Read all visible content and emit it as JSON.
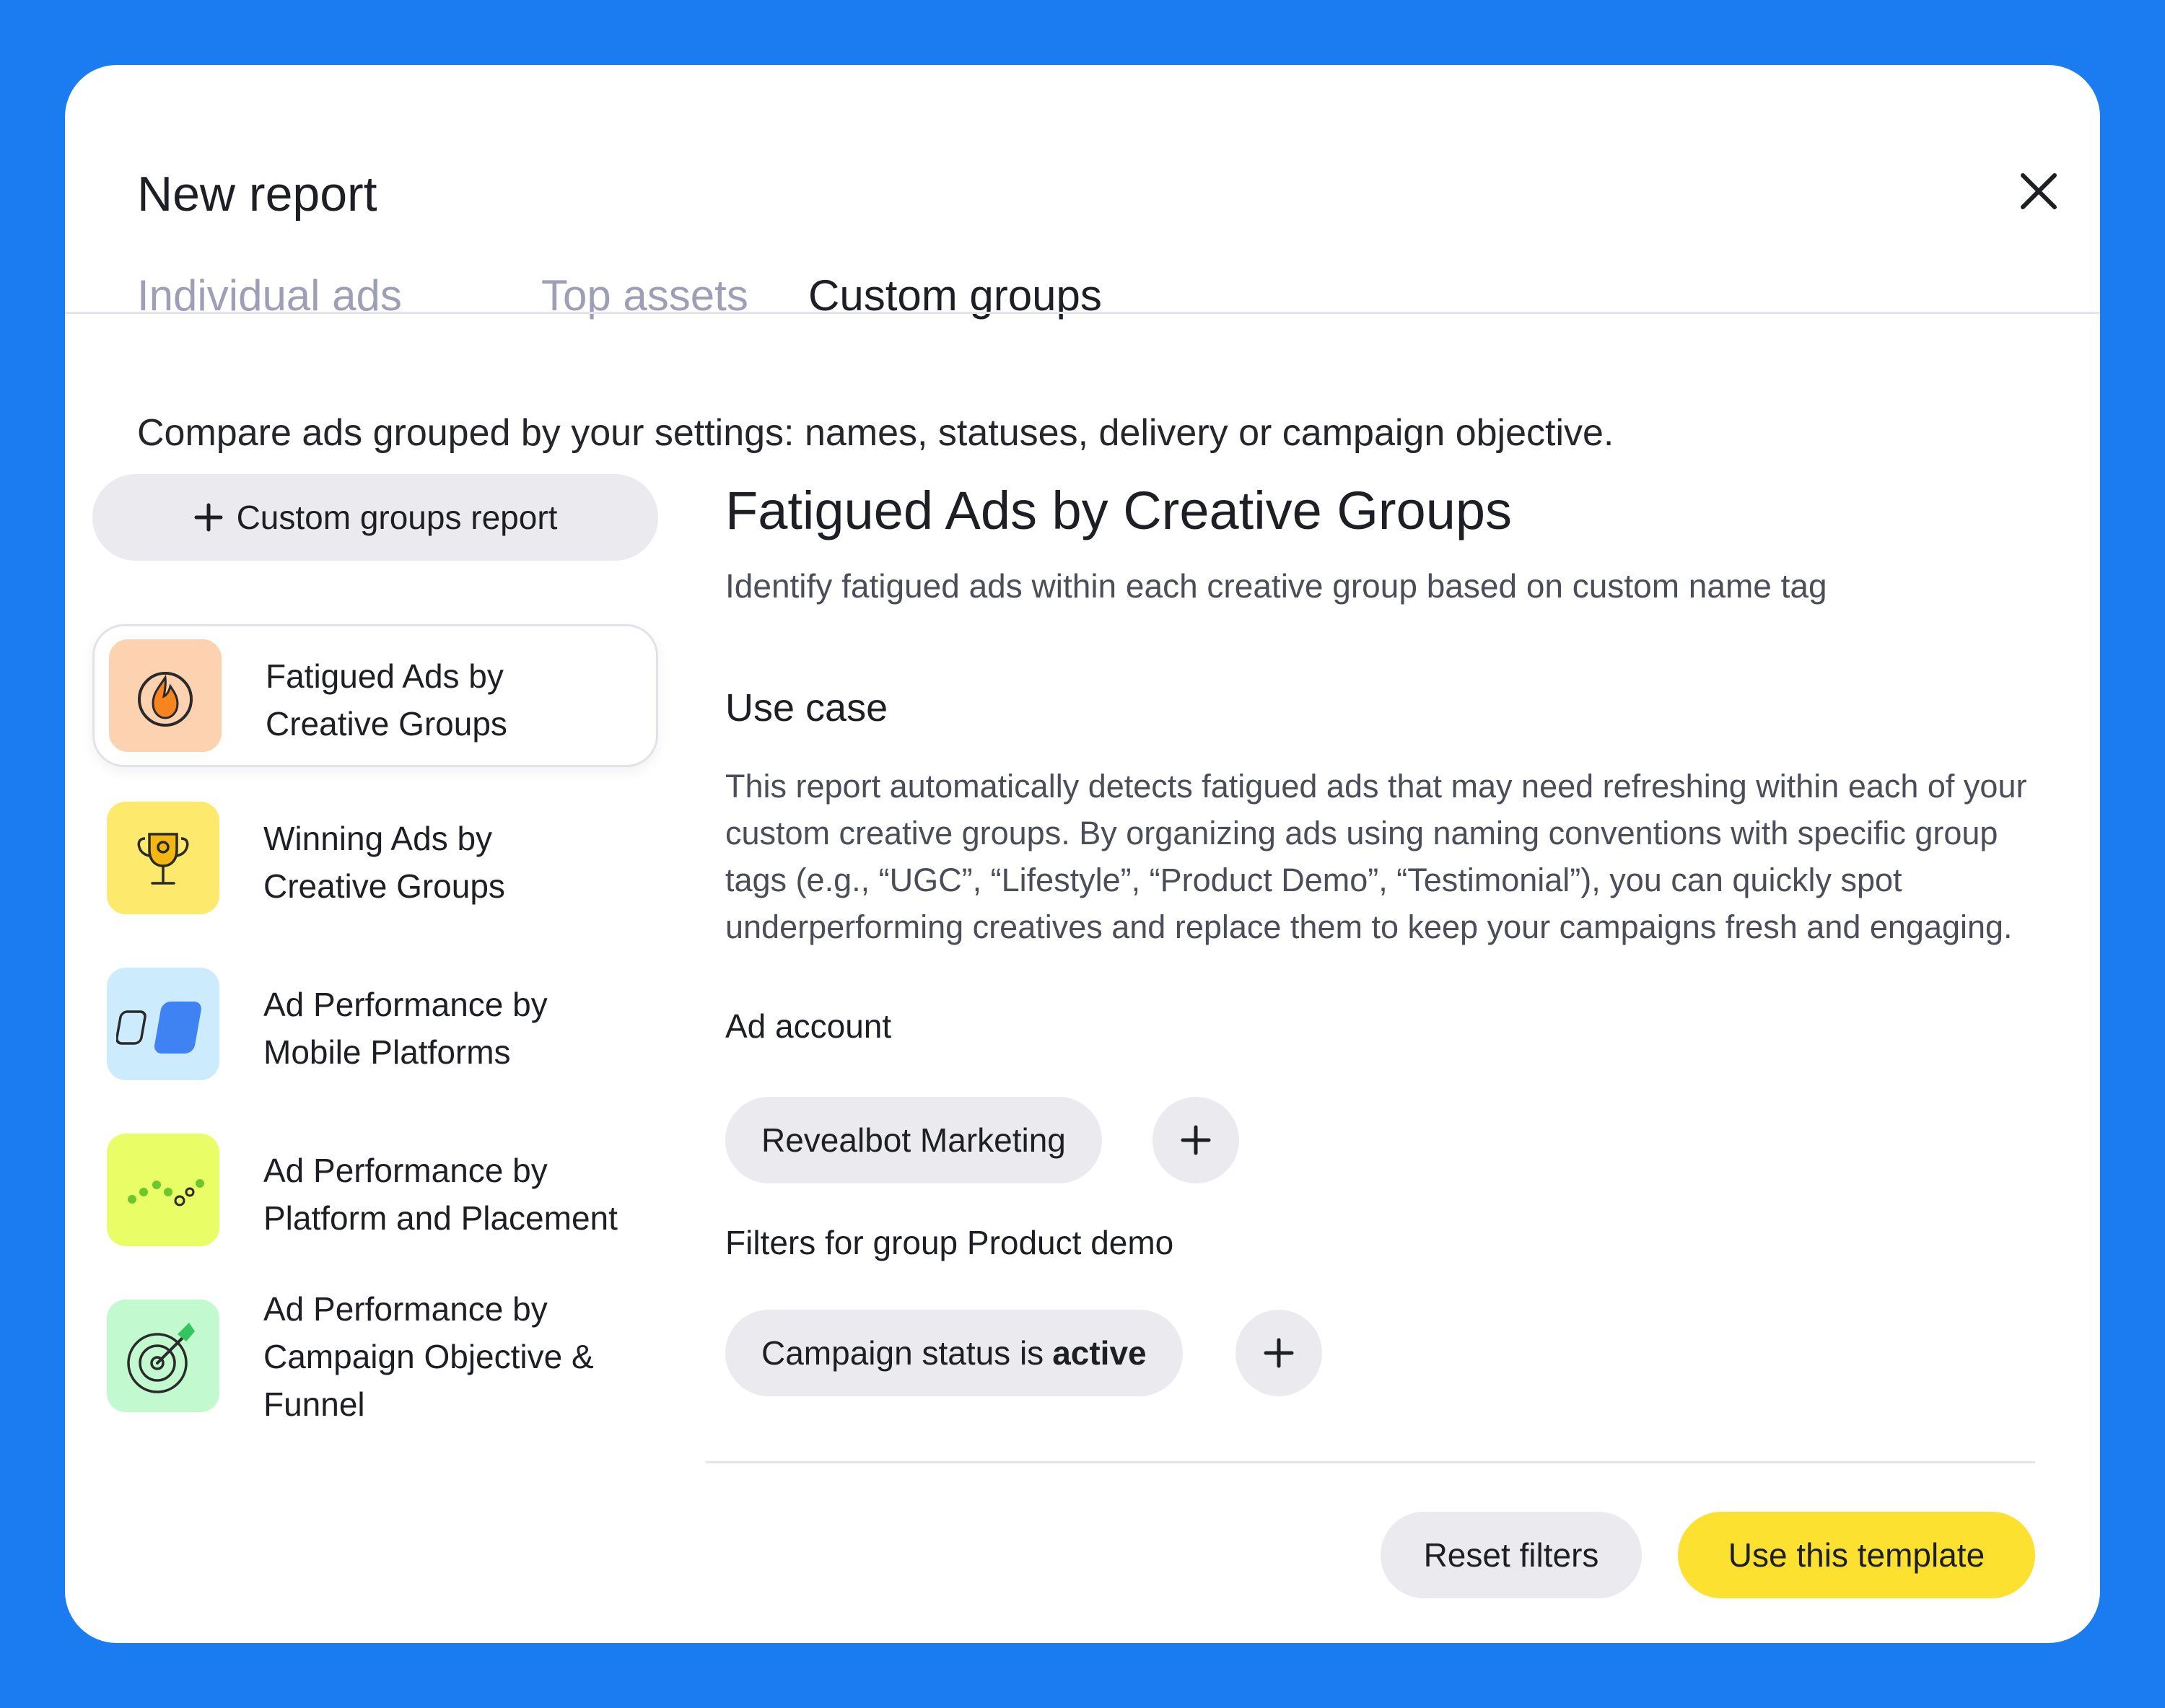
{
  "modal": {
    "title": "New report",
    "tabs": [
      {
        "label": "Individual ads",
        "active": false
      },
      {
        "label": "Top assets",
        "active": false
      },
      {
        "label": "Custom groups",
        "active": true
      }
    ],
    "subtitle": "Compare ads grouped by your settings: names, statuses, delivery or campaign objective."
  },
  "sidebar": {
    "add_button_label": "Custom groups report",
    "templates": [
      {
        "line1": "Fatigued Ads by",
        "line2": "Creative Groups",
        "line3": "",
        "icon": "flame-icon",
        "color": "#fdd2b0",
        "selected": true
      },
      {
        "line1": "Winning Ads by",
        "line2": "Creative Groups",
        "line3": "",
        "icon": "trophy-icon",
        "color": "#fde96b",
        "selected": false
      },
      {
        "line1": "Ad Performance by",
        "line2": "Mobile Platforms",
        "line3": "",
        "icon": "mobile-platforms-icon",
        "color": "#ccecfd",
        "selected": false
      },
      {
        "line1": "Ad Performance by",
        "line2": "Platform and Placement",
        "line3": "",
        "icon": "placement-dots-icon",
        "color": "#e8fd66",
        "selected": false
      },
      {
        "line1": "Ad Performance by",
        "line2": "Campaign Objective &",
        "line3": "Funnel",
        "icon": "target-icon",
        "color": "#c2f9cf",
        "selected": false
      }
    ]
  },
  "detail": {
    "title": "Fatigued Ads by Creative Groups",
    "description": "Identify fatigued ads within each creative group based on custom name tag",
    "use_case_heading": "Use case",
    "use_case_text": "This report automatically detects fatigued ads that may need refreshing within each of your custom creative groups. By organizing ads using naming conventions with specific group tags (e.g., “UGC”, “Lifestyle”, “Product Demo”, “Testimonial”), you can quickly spot underperforming creatives and replace them to keep your campaigns fresh and engaging.",
    "ad_account_label": "Ad account",
    "ad_account_chip": "Revealbot Marketing",
    "filters_label": "Filters for group Product demo",
    "filter_chip_prefix": "Campaign status is",
    "filter_chip_value": "active"
  },
  "footer": {
    "reset_label": "Reset filters",
    "use_template_label": "Use this template"
  },
  "colors": {
    "background": "#1b7cf2",
    "primary_button": "#fde131",
    "chip": "#ebebef",
    "inactive_tab": "#9e9fb7"
  }
}
